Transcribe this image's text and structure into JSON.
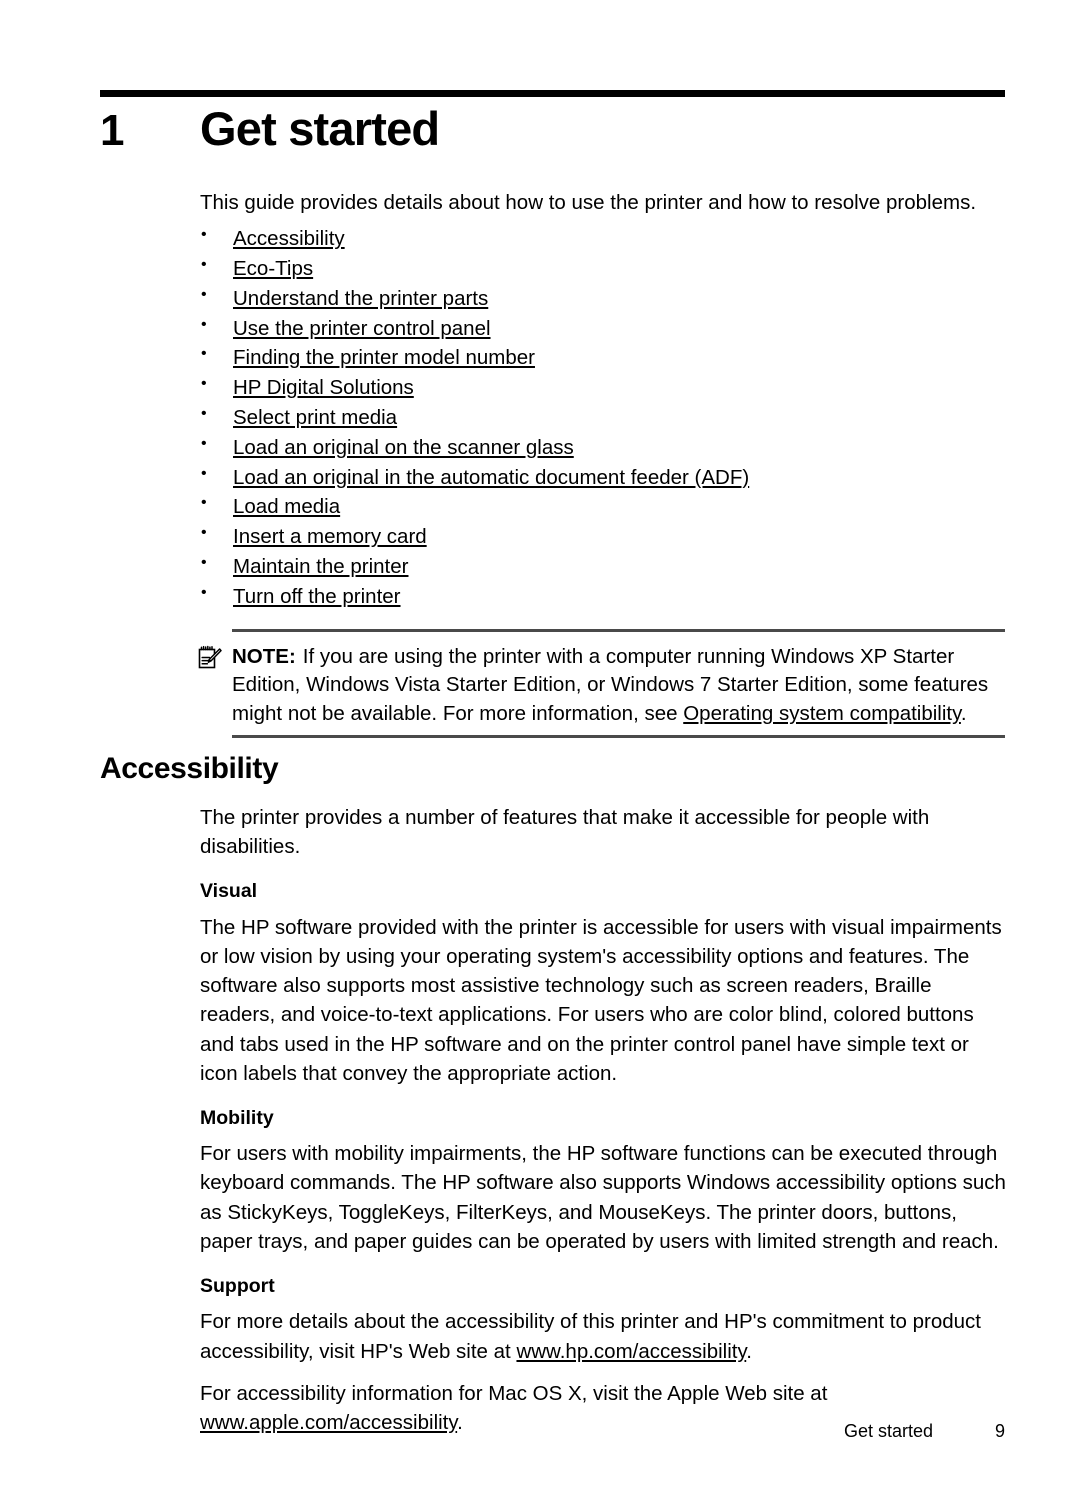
{
  "chapter": {
    "number": "1",
    "title": "Get started"
  },
  "intro": {
    "paragraph": "This guide provides details about how to use the printer and how to resolve problems."
  },
  "toc": {
    "items": [
      {
        "label": "Accessibility"
      },
      {
        "label": "Eco-Tips"
      },
      {
        "label": "Understand the printer parts"
      },
      {
        "label": "Use the printer control panel"
      },
      {
        "label": "Finding the printer model number"
      },
      {
        "label": "HP Digital Solutions"
      },
      {
        "label": "Select print media"
      },
      {
        "label": "Load an original on the scanner glass"
      },
      {
        "label": "Load an original in the automatic document feeder (ADF)"
      },
      {
        "label": "Load media"
      },
      {
        "label": "Insert a memory card"
      },
      {
        "label": "Maintain the printer"
      },
      {
        "label": "Turn off the printer"
      }
    ]
  },
  "note": {
    "icon": "note-pencil-icon",
    "label": "NOTE:",
    "text_before_link": "If you are using the printer with a computer running Windows XP Starter Edition, Windows Vista Starter Edition, or Windows 7 Starter Edition, some features might not be available. For more information, see ",
    "link": "Operating system compatibility",
    "text_after_link": "."
  },
  "accessibility": {
    "heading": "Accessibility",
    "intro": "The printer provides a number of features that make it accessible for people with disabilities.",
    "visual": {
      "heading": "Visual",
      "text": "The HP software provided with the printer is accessible for users with visual impairments or low vision by using your operating system's accessibility options and features. The software also supports most assistive technology such as screen readers, Braille readers, and voice-to-text applications. For users who are color blind, colored buttons and tabs used in the HP software and on the printer control panel have simple text or icon labels that convey the appropriate action."
    },
    "mobility": {
      "heading": "Mobility",
      "text": "For users with mobility impairments, the HP software functions can be executed through keyboard commands. The HP software also supports Windows accessibility options such as StickyKeys, ToggleKeys, FilterKeys, and MouseKeys. The printer doors, buttons, paper trays, and paper guides can be operated by users with limited strength and reach."
    },
    "support": {
      "heading": "Support",
      "para1_before_link": "For more details about the accessibility of this printer and HP's commitment to product accessibility, visit HP's Web site at ",
      "para1_link": "www.hp.com/accessibility",
      "para1_after_link": ".",
      "para2_before_link": "For accessibility information for Mac OS X, visit the Apple Web site at ",
      "para2_link": "www.apple.com/accessibility",
      "para2_after_link": "."
    }
  },
  "footer": {
    "title": "Get started",
    "page": "9"
  }
}
